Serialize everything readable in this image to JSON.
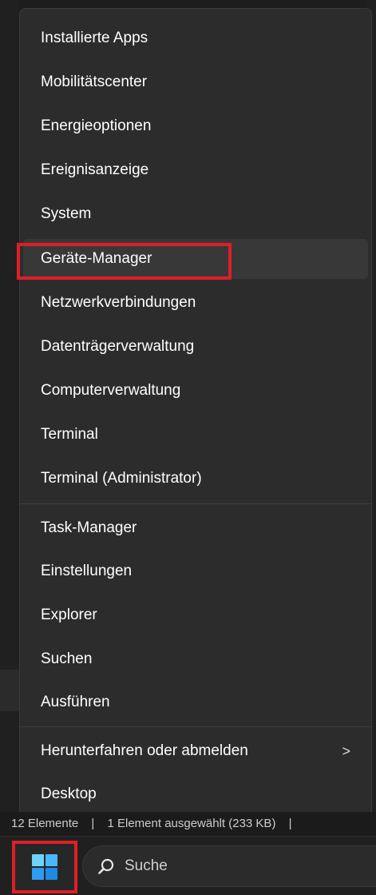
{
  "menu": {
    "items": [
      {
        "label": "Installierte Apps"
      },
      {
        "label": "Mobilitätscenter"
      },
      {
        "label": "Energieoptionen"
      },
      {
        "label": "Ereignisanzeige"
      },
      {
        "label": "System"
      },
      {
        "label": "Geräte-Manager"
      },
      {
        "label": "Netzwerkverbindungen"
      },
      {
        "label": "Datenträgerverwaltung"
      },
      {
        "label": "Computerverwaltung"
      },
      {
        "label": "Terminal"
      },
      {
        "label": "Terminal (Administrator)"
      },
      {
        "label": "Task-Manager"
      },
      {
        "label": "Einstellungen"
      },
      {
        "label": "Explorer"
      },
      {
        "label": "Suchen"
      },
      {
        "label": "Ausführen"
      },
      {
        "label": "Herunterfahren oder abmelden",
        "submenu_indicator": ">"
      },
      {
        "label": "Desktop"
      }
    ]
  },
  "statusbar": {
    "item_count": "12 Elemente",
    "selection": "1 Element ausgewählt (233 KB)"
  },
  "taskbar": {
    "search_label": "Suche",
    "start_icon": "windows-logo-icon",
    "search_icon": "search-icon"
  },
  "colors": {
    "highlight": "#e01e26",
    "menu_bg": "#2c2c2c",
    "accent": "#4cc2ff"
  }
}
